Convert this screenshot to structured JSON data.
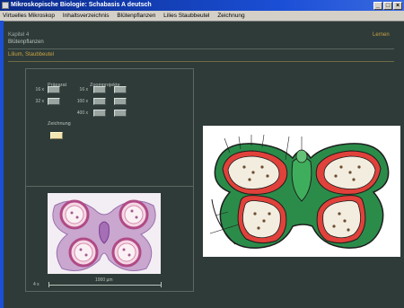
{
  "window": {
    "title": "Mikroskopische Biologie: Schabasis A deutsch",
    "controls": [
      "_",
      "□",
      "×"
    ]
  },
  "menu": {
    "items": [
      "Virtuelles Mikroskop",
      "Inhaltsverzeichnis",
      "Blütenpflanzen",
      "Lilies Staubbeutel",
      "Zeichnung"
    ]
  },
  "header": {
    "chapter": "Kapitel 4",
    "subchapter": "Blütenpflanzen",
    "lernen": "Lernen",
    "section": "Lilium, Staubbeutel"
  },
  "controls_panel": {
    "praeparat_header": "Präparat",
    "zoom_header": "Zoomprojekte",
    "rows": [
      {
        "left_label": "16 x",
        "right_label": "16 x"
      },
      {
        "left_label": "32 x",
        "right_label": "100 x"
      },
      {
        "left_label": "",
        "right_label": "400 x"
      }
    ],
    "zeichnung_label": "Zeichnung"
  },
  "micrograph": {
    "magnification": "4 x",
    "scale": "1000 µm"
  },
  "colors": {
    "background": "#2f3b38",
    "accent_gold": "#c9a347",
    "title_blue": "#1b4fd6"
  }
}
